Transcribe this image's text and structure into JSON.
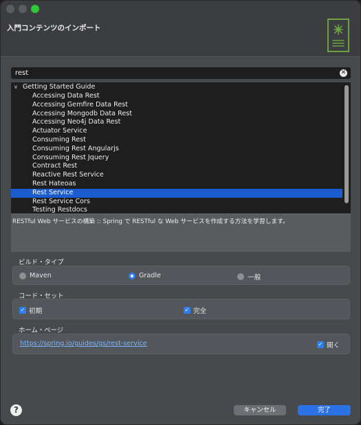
{
  "window": {
    "title": "入門コンテンツのインポート"
  },
  "search": {
    "value": "rest"
  },
  "tree": {
    "root_label": "Getting Started Guide",
    "items": [
      "Accessing Data Rest",
      "Accessing Gemfire Data Rest",
      "Accessing Mongodb Data Rest",
      "Accessing Neo4j Data Rest",
      "Actuator Service",
      "Consuming Rest",
      "Consuming Rest Angularjs",
      "Consuming Rest Jquery",
      "Contract Rest",
      "Reactive Rest Service",
      "Rest Hateoas",
      "Rest Service",
      "Rest Service Cors",
      "Testing Restdocs"
    ],
    "selected": "Rest Service"
  },
  "description": "RESTful Web サービスの構築 :: Spring で RESTful な Web サービスを作成する方法を学習します。",
  "build_type": {
    "label": "ビルド・タイプ",
    "options": [
      "Maven",
      "Gradle",
      "一般"
    ],
    "selected": "Gradle"
  },
  "code_set": {
    "label": "コード・セット",
    "options": [
      {
        "label": "初期",
        "checked": true
      },
      {
        "label": "完全",
        "checked": true
      }
    ]
  },
  "home_page": {
    "label": "ホーム・ページ",
    "url": "https://spring.io/guides/gs/rest-service",
    "open_label": "開く",
    "open_checked": true
  },
  "footer": {
    "help_glyph": "?",
    "cancel_label": "キャンセル",
    "ok_label": "完了"
  },
  "colors": {
    "accent": "#2b72e6",
    "selection": "#1b5cd0",
    "banner": "#6aa33f",
    "link": "#79b8ff"
  }
}
